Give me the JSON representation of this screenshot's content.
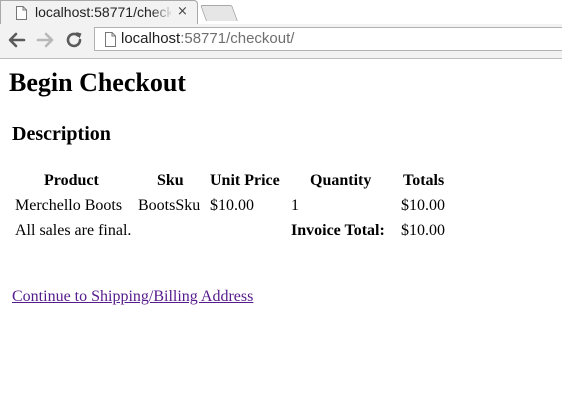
{
  "browser": {
    "tab_title": "localhost:58771/checkout/",
    "tab_close": "×",
    "url_host": "localhost",
    "url_rest": ":58771/checkout/"
  },
  "page": {
    "title": "Begin Checkout",
    "section_title": "Description",
    "table": {
      "headers": [
        "Product",
        "Sku",
        "Unit Price",
        "Quantity",
        "Totals"
      ],
      "rows": [
        [
          "Merchello Boots",
          "BootsSku",
          "$10.00",
          "1",
          "$10.00"
        ]
      ],
      "footer_note": "All sales are final.",
      "invoice_total_label": "Invoice Total:",
      "invoice_total_value": "$10.00"
    },
    "continue_link": "Continue to Shipping/Billing Address"
  },
  "colors": {
    "link_visited": "#551a8b",
    "chrome_bg": "#f2f2f2"
  },
  "icons": [
    "page-icon",
    "close-icon",
    "back-arrow-icon",
    "forward-arrow-icon",
    "reload-icon"
  ]
}
